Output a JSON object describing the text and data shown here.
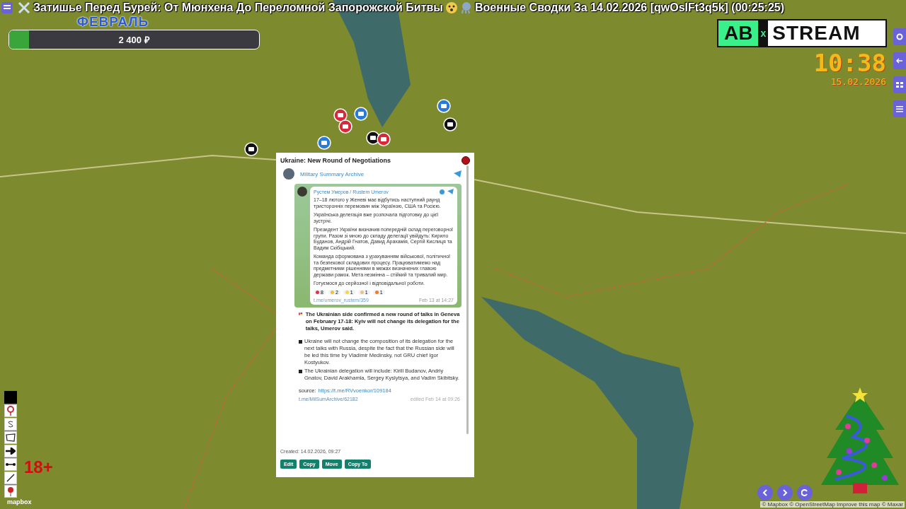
{
  "stream_title": {
    "main": "Затишье Перед Бурей: От Мюнхена До Переломной Запорожской Битвы",
    "suffix": "Военные Сводки За 14.02.2026 [qwOsIFt3q5k] (00:25:25)"
  },
  "goal": {
    "label": "ФЕВРАЛЬ",
    "amount": "2 400 ₽",
    "level": 0.08
  },
  "logo": {
    "left": "AB",
    "mark": "x",
    "right": "STREAM"
  },
  "clock": {
    "time": "10:38",
    "date": "15.02.2026"
  },
  "side_buttons": [
    {
      "kind": "gear"
    },
    {
      "kind": "back"
    },
    {
      "kind": "grid"
    },
    {
      "kind": "list"
    }
  ],
  "popup": {
    "title": "Ukraine: New Round of Negotiations",
    "channel": "Military Summary Archive",
    "embed": {
      "author": "Рустем Умєров / Rustem Umerov",
      "paragraphs": [
        "17–18 лютого у Женеві має відбутись наступний раунд тристоронніх перемовин між Україною, США та Росією.",
        "Українська делегація вже розпочала підготовку до цієї зустрічі.",
        "Президент України визначив попередній склад переговорної групи. Разом зі мною до складу делегації увійдуть: Кирило Буданов, Андрій Гнатов, Давид Арахамія, Сергій Кислиця та Вадим Скібіцький.",
        "Команда сформована з урахуванням військової, політичної та безпекової складових процесу. Працюватимемо над предметними рішеннями в межах визначених главою держави рамок. Мета незмінна – стійкий та тривалий мир.",
        "Готуємося до серйозної і відповідальної роботи."
      ],
      "reactions": [
        {
          "kind": "heart",
          "count": "8"
        },
        {
          "kind": "laugh",
          "count": "2"
        },
        {
          "kind": "bulb",
          "count": "1"
        },
        {
          "kind": "pray",
          "count": "1"
        },
        {
          "kind": "angry",
          "count": "1"
        }
      ],
      "link": "t.me/umerov_rustem/359",
      "time": "Feb 13 at 14:27"
    },
    "headline": "The Ukrainian side confirmed a new round of talks in Geneva on February 17-18: Kyiv will not change its delegation for the talks, Umerov said.",
    "bullets": [
      "Ukraine will not change the composition of its delegation for the next talks with Russia, despite the fact that the Russian side will be led this time by Vladimir Medinsky, not GRU chief Igor Kostyukov.",
      "The Ukrainian delegation will include: Kirill Budanov, Andriy Gnatov, David Arakhamia, Sergey Kyslytsya, and Vadim Skibitsky."
    ],
    "source_label": "source:",
    "source_link": "https://t.me/RVvoenkor/109184",
    "post_link": "t.me/MilSumArchive/62182",
    "edited": "edited Feb 14 at 09:26",
    "created": "Created: 14.02.2026, 09:27",
    "buttons": [
      "Edit",
      "Copy",
      "Move",
      "Copy To"
    ]
  },
  "tools": [
    {
      "kind": "square"
    },
    {
      "kind": "pin"
    },
    {
      "kind": "s"
    },
    {
      "kind": "polygon"
    },
    {
      "kind": "arrow"
    },
    {
      "kind": "measure"
    },
    {
      "kind": "line"
    },
    {
      "kind": "marker"
    }
  ],
  "map_brand": "mapbox",
  "age_rating": "18+",
  "nav_buttons": [
    {
      "kind": "prev"
    },
    {
      "kind": "next"
    },
    {
      "kind": "reload"
    }
  ],
  "attribution": "© Mapbox © OpenStreetMap Improve this map © Maxar"
}
